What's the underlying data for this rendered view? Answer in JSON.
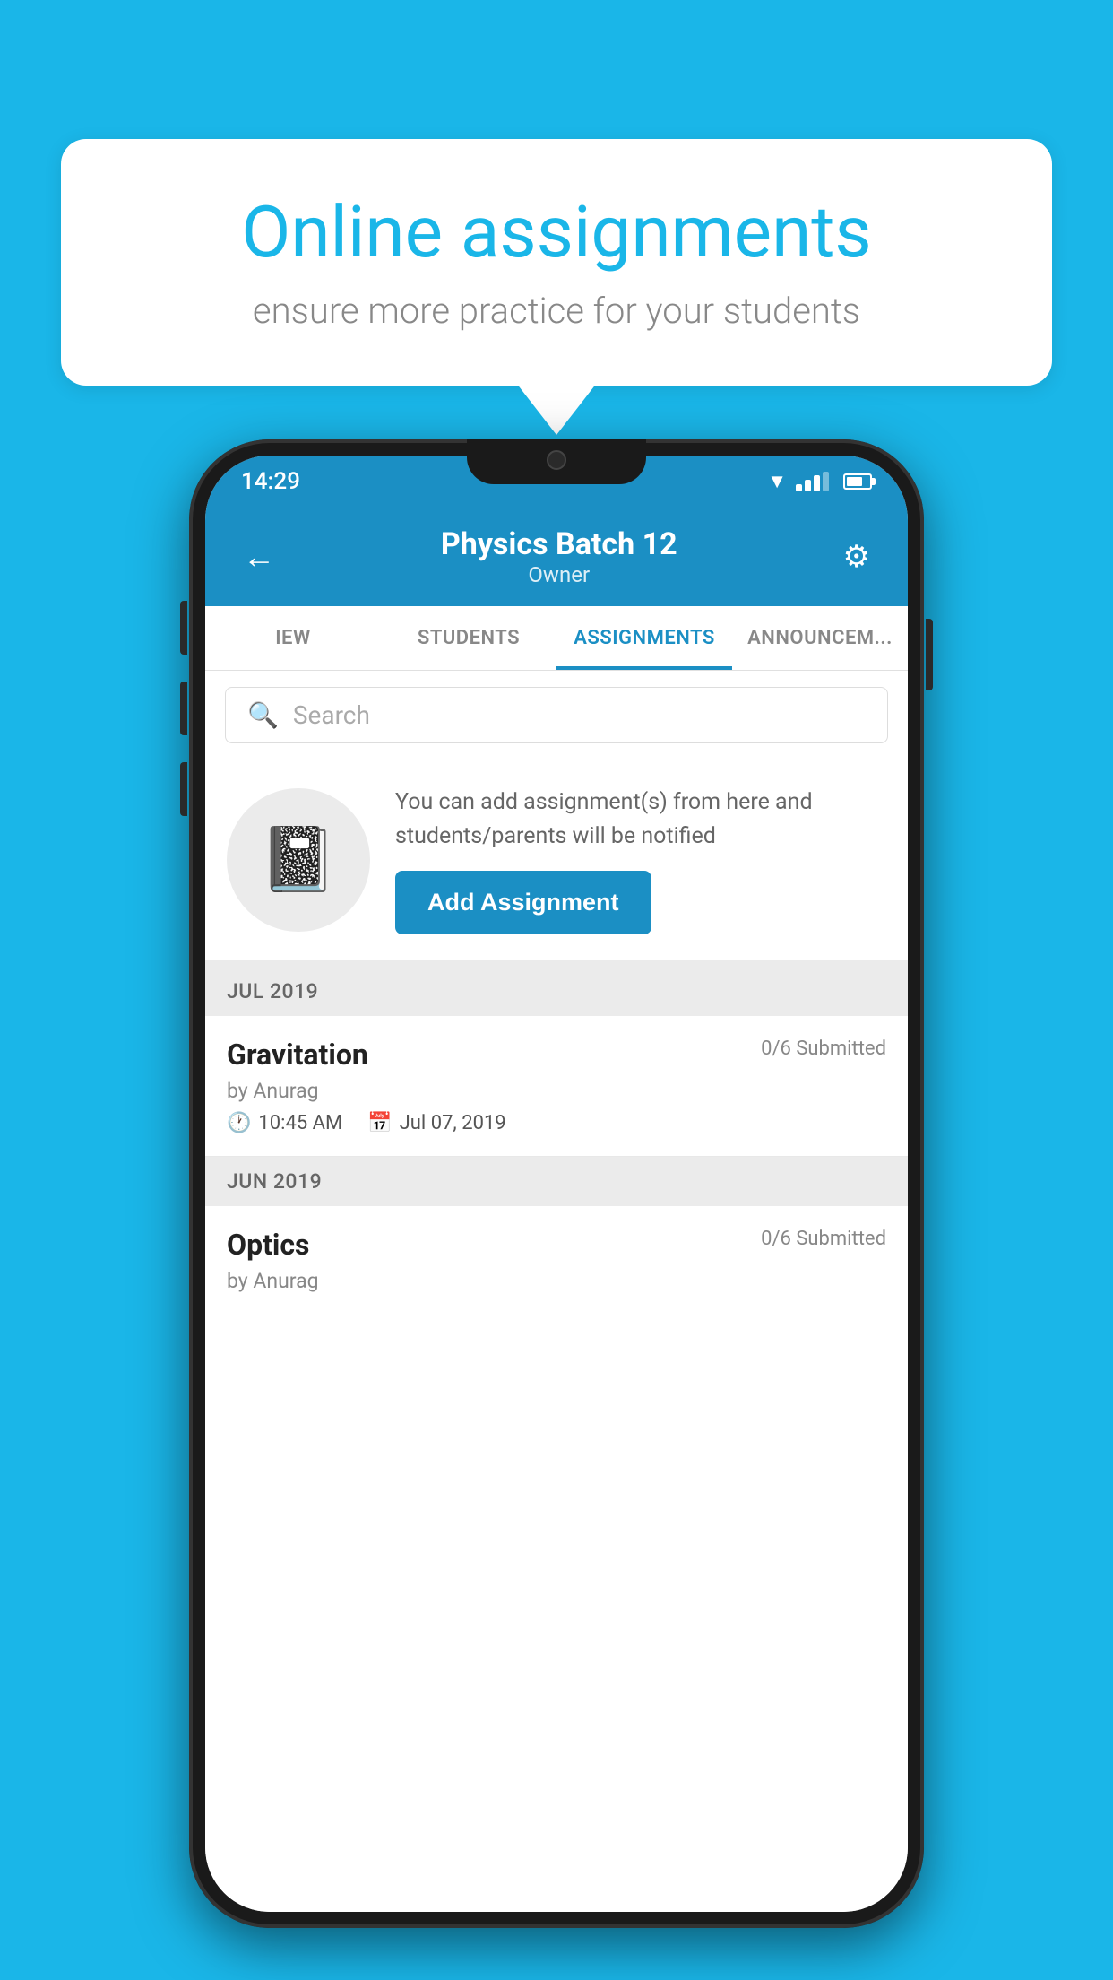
{
  "background_color": "#1ab6e8",
  "speech_bubble": {
    "title": "Online assignments",
    "subtitle": "ensure more practice for your students"
  },
  "status_bar": {
    "time": "14:29"
  },
  "header": {
    "title": "Physics Batch 12",
    "subtitle": "Owner",
    "back_label": "←",
    "settings_label": "⚙"
  },
  "tabs": [
    {
      "label": "IEW",
      "active": false
    },
    {
      "label": "STUDENTS",
      "active": false
    },
    {
      "label": "ASSIGNMENTS",
      "active": true
    },
    {
      "label": "ANNOUNCEM...",
      "active": false
    }
  ],
  "search": {
    "placeholder": "Search"
  },
  "promo": {
    "text": "You can add assignment(s) from here and students/parents will be notified",
    "button_label": "Add Assignment"
  },
  "sections": [
    {
      "header": "JUL 2019",
      "assignments": [
        {
          "name": "Gravitation",
          "submitted": "0/6 Submitted",
          "author": "by Anurag",
          "time": "10:45 AM",
          "date": "Jul 07, 2019"
        }
      ]
    },
    {
      "header": "JUN 2019",
      "assignments": [
        {
          "name": "Optics",
          "submitted": "0/6 Submitted",
          "author": "by Anurag",
          "time": "",
          "date": ""
        }
      ]
    }
  ]
}
